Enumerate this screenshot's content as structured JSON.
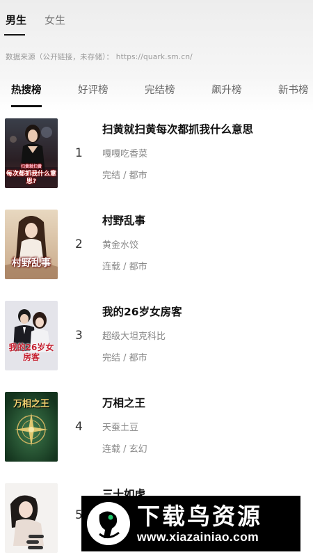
{
  "gender_tabs": [
    {
      "label": "男生",
      "active": true
    },
    {
      "label": "女生",
      "active": false
    }
  ],
  "source_line": "数据来源（公开链接，未存储）： https://quark.sm.cn/",
  "rank_tabs": [
    {
      "label": "热搜榜",
      "active": true
    },
    {
      "label": "好评榜",
      "active": false
    },
    {
      "label": "完结榜",
      "active": false
    },
    {
      "label": "飙升榜",
      "active": false
    },
    {
      "label": "新书榜",
      "active": false
    }
  ],
  "books": [
    {
      "rank": "1",
      "title": "扫黄就扫黄每次都抓我什么意思",
      "author": "嘎嘎吃香菜",
      "meta": "完结 / 都市",
      "cover_text": "每次都抓我什么意思?",
      "cover_subtitle": "扫黄就扫黄"
    },
    {
      "rank": "2",
      "title": "村野乱事",
      "author": "黄金水饺",
      "meta": "连载 / 都市",
      "cover_text": "村野乱事"
    },
    {
      "rank": "3",
      "title": "我的26岁女房客",
      "author": "超级大坦克科比",
      "meta": "完结 / 都市",
      "cover_text": "我的26岁女房客"
    },
    {
      "rank": "4",
      "title": "万相之王",
      "author": "天蚕土豆",
      "meta": "连载 / 玄幻",
      "cover_text": "万相之王"
    },
    {
      "rank": "5",
      "title": "三十如虎",
      "author": "",
      "meta": "",
      "cover_text": ""
    }
  ],
  "watermark": {
    "name": "下载鸟资源",
    "url": "www.xiazainiao.com"
  },
  "colors": {
    "active_text": "#111111",
    "inactive_text": "#666666",
    "meta_text": "#888888",
    "watermark_bg": "#000000"
  },
  "icons": {
    "bottom_nav": "stack-icon",
    "watermark_logo": "bird-logo-icon"
  }
}
